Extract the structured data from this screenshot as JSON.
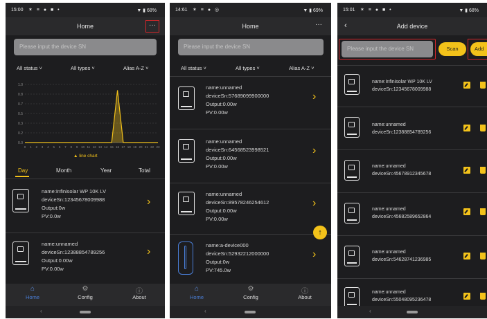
{
  "screen1": {
    "status": {
      "time": "15:00",
      "icons": "✶ ≡ ● ■ •",
      "battery": "▼ ▮ 68%"
    },
    "title": "Home",
    "more_icon": "more-icon",
    "search_placeholder": "Please input the device SN",
    "filters": {
      "status": "All status ˅",
      "types": "All types ˅",
      "sort": "Alias A-Z ˅"
    },
    "chart_legend": "▲ line chart",
    "periods": [
      "Day",
      "Month",
      "Year",
      "Total"
    ],
    "devices": [
      {
        "name": "name:Infinisolar WP 10K LV",
        "sn": "deviceSn:12345678009988",
        "output": "Output:0w",
        "pv": "PV:0.0w"
      },
      {
        "name": "name:unnamed",
        "sn": "deviceSn:12388854789256",
        "output": "Output:0.00w",
        "pv": "PV:0.00w"
      }
    ],
    "nav": [
      {
        "label": "Home",
        "icon": "home-icon"
      },
      {
        "label": "Config",
        "icon": "config-icon"
      },
      {
        "label": "About",
        "icon": "about-icon"
      }
    ]
  },
  "screen2": {
    "status": {
      "time": "14:61",
      "icons": "✶ ≡ ● ◎",
      "battery": "▼ ▮ 69%"
    },
    "title": "Home",
    "search_placeholder": "Please input the device SN",
    "filters": {
      "status": "All status ˅",
      "types": "All types ˅",
      "sort": "Alias A-Z ˅"
    },
    "devices": [
      {
        "name": "name:unnamed",
        "sn": "deviceSn:57689099900000",
        "output": "Output:0.00w",
        "pv": "PV:0.00w"
      },
      {
        "name": "name:unnamed",
        "sn": "deviceSn:64568523998521",
        "output": "Output:0.00w",
        "pv": "PV:0.00w"
      },
      {
        "name": "name:unnamed",
        "sn": "deviceSn:89578246254612",
        "output": "Output:0.00w",
        "pv": "PV:0.00w"
      },
      {
        "name": "name:a-device000",
        "sn": "deviceSn:52932212000000",
        "output": "Output:0w",
        "pv": "PV:745.0w"
      }
    ],
    "nav": [
      {
        "label": "Home",
        "icon": "home-icon"
      },
      {
        "label": "Config",
        "icon": "config-icon"
      },
      {
        "label": "About",
        "icon": "about-icon"
      }
    ]
  },
  "screen3": {
    "status": {
      "time": "15:01",
      "icons": "✶ ≡ ● ■ •",
      "battery": "▼ ▮ 68%"
    },
    "title": "Add device",
    "search_placeholder": "Please input the device SN",
    "scan_label": "Scan",
    "add_label": "Add",
    "devices": [
      {
        "name": "name:Infinisolar WP 10K LV",
        "sn": "deviceSn:12345678009988"
      },
      {
        "name": "name:unnamed",
        "sn": "deviceSn:12388854789256"
      },
      {
        "name": "name:unnamed",
        "sn": "deviceSn:45678912345678"
      },
      {
        "name": "name:unnamed",
        "sn": "deviceSn:45682589652864"
      },
      {
        "name": "name:unnamed",
        "sn": "deviceSn:54628741236985"
      },
      {
        "name": "name:unnamed",
        "sn": "deviceSn:55048095236478"
      }
    ]
  },
  "chart_data": {
    "type": "line",
    "x": [
      0,
      1,
      2,
      3,
      4,
      5,
      6,
      7,
      8,
      9,
      10,
      11,
      12,
      13,
      14,
      15,
      16,
      17,
      18,
      19,
      20,
      21,
      22,
      23
    ],
    "values": [
      0,
      0,
      0,
      0,
      0,
      0,
      0,
      0,
      0,
      0,
      0,
      0,
      0,
      0,
      0,
      0,
      0.9,
      0,
      0,
      0,
      0,
      0,
      0,
      0
    ],
    "ylim": [
      0,
      1
    ],
    "series_color": "#f3c21a",
    "grid": true
  },
  "colors": {
    "accent": "#f3c21a",
    "background": "#1d1d1f",
    "nav_active": "#4a7fd8",
    "highlight_box": "#d6262a"
  }
}
